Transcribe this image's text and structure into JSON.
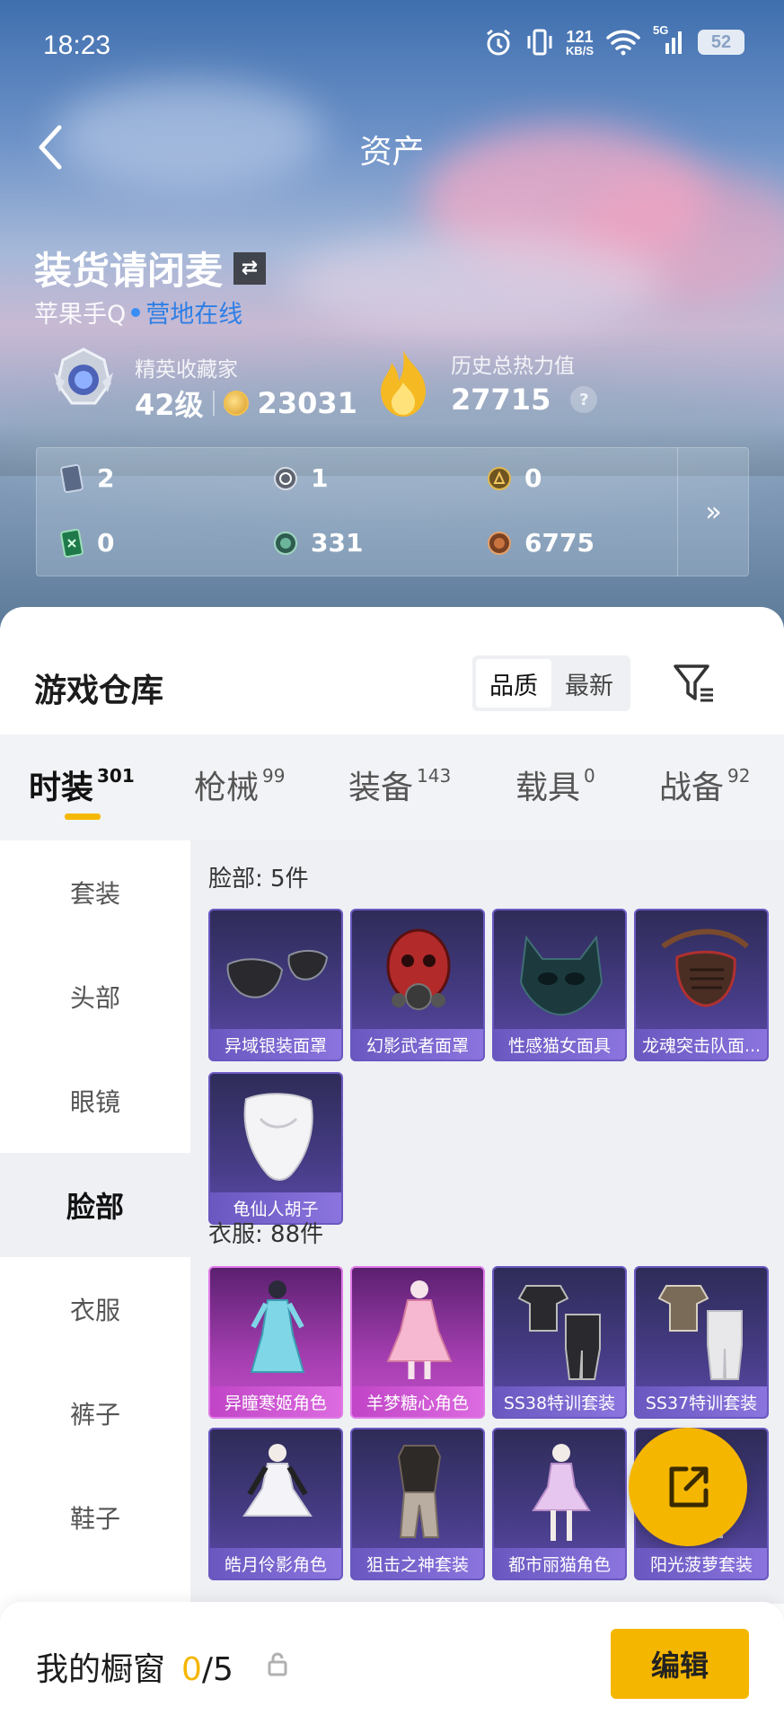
{
  "status_bar": {
    "time": "18:23",
    "net_speed_value": "121",
    "net_speed_unit": "KB/S",
    "network": "5G",
    "battery": "52"
  },
  "nav": {
    "title": "资产"
  },
  "profile": {
    "username": "装货请闭麦",
    "switch_icon": "swap-icon",
    "platform": "苹果手Q",
    "online_status": "营地在线",
    "rank_title": "精英收藏家",
    "level": "42级",
    "coins": "23031",
    "heat_label": "历史总热力值",
    "heat_value": "27715",
    "help": "?"
  },
  "stats": [
    {
      "icon": "card-icon",
      "value": "2"
    },
    {
      "icon": "silver-medal-icon",
      "value": "1"
    },
    {
      "icon": "gold-medal-icon",
      "value": "0"
    },
    {
      "icon": "green-card-icon",
      "value": "0"
    },
    {
      "icon": "green-coin-icon",
      "value": "331"
    },
    {
      "icon": "bronze-coin-icon",
      "value": "6775"
    }
  ],
  "stats_more": "»",
  "warehouse": {
    "title": "游戏仓库",
    "sort_options": [
      "品质",
      "最新"
    ],
    "active_sort": "品质"
  },
  "tabs": [
    {
      "label": "时装",
      "count": "301"
    },
    {
      "label": "枪械",
      "count": "99"
    },
    {
      "label": "装备",
      "count": "143"
    },
    {
      "label": "载具",
      "count": "0"
    },
    {
      "label": "战备",
      "count": "92"
    }
  ],
  "side_menu": [
    "套装",
    "头部",
    "眼镜",
    "脸部",
    "衣服",
    "裤子",
    "鞋子"
  ],
  "active_side": "脸部",
  "sections": {
    "face": {
      "title": "脸部: 5件",
      "items": [
        "异域银装面罩",
        "幻影武者面罩",
        "性感猫女面具",
        "龙魂突击队面...",
        "龟仙人胡子"
      ]
    },
    "clothes": {
      "title": "衣服: 88件",
      "items": [
        "异瞳寒姬角色",
        "羊梦糖心角色",
        "SS38特训套装",
        "SS37特训套装",
        "皓月伶影角色",
        "狙击之神套装",
        "都市丽猫角色",
        "阳光菠萝套装"
      ]
    }
  },
  "bottom": {
    "label": "我的橱窗",
    "current": "0",
    "total": "/5",
    "edit": "编辑"
  },
  "colors": {
    "accent": "#f5b600",
    "online": "#2d7fe6",
    "item_purple": "#6a58c0",
    "item_pink": "#c145c7"
  }
}
